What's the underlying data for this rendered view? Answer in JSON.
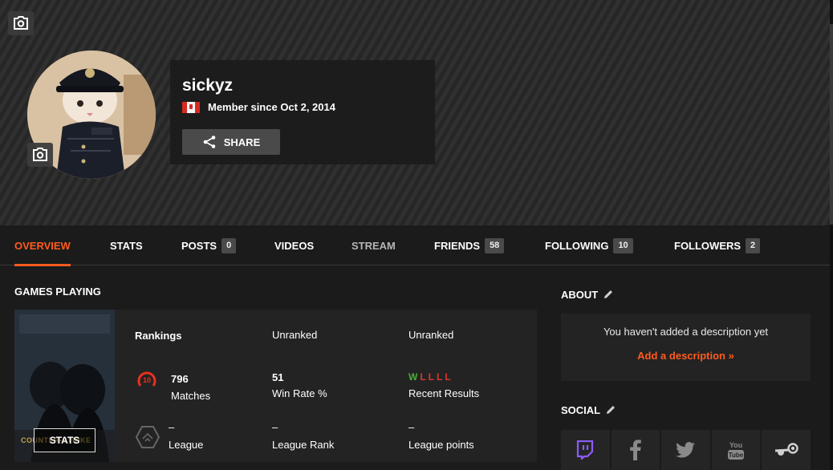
{
  "profile": {
    "username": "sickyz",
    "member_since": "Member since Oct 2, 2014",
    "share_label": "SHARE",
    "flag": "canada-flag-icon"
  },
  "tabs": [
    {
      "label": "OVERVIEW",
      "active": true
    },
    {
      "label": "STATS"
    },
    {
      "label": "POSTS",
      "count": "0"
    },
    {
      "label": "VIDEOS"
    },
    {
      "label": "STREAM",
      "muted": true
    },
    {
      "label": "FRIENDS",
      "count": "58"
    },
    {
      "label": "FOLLOWING",
      "count": "10"
    },
    {
      "label": "FOLLOWERS",
      "count": "2"
    }
  ],
  "games": {
    "title": "GAMES PLAYING",
    "cover_logo": "COUNTER-STRIKE",
    "stats_button": "STATS",
    "rankings_label": "Rankings",
    "ranking_1": "Unranked",
    "ranking_2": "Unranked",
    "skill_level": "10",
    "matches_value": "796",
    "matches_label": "Matches",
    "winrate_value": "51",
    "winrate_label": "Win Rate %",
    "recent_results": [
      "W",
      "L",
      "L",
      "L",
      "L"
    ],
    "recent_label": "Recent Results",
    "league_value": "–",
    "league_label": "League",
    "league_rank_value": "–",
    "league_rank_label": "League Rank",
    "league_points_value": "–",
    "league_points_label": "League points"
  },
  "about": {
    "title": "ABOUT",
    "empty_text": "You haven't added a description yet",
    "add_link": "Add a description »"
  },
  "social": {
    "title": "SOCIAL",
    "icons": [
      "twitch-icon",
      "facebook-icon",
      "twitter-icon",
      "youtube-icon",
      "steam-icon"
    ]
  },
  "colors": {
    "accent": "#ff5b1f",
    "win": "#4caf3a",
    "loss": "#d9362b",
    "twitch": "#6441a5"
  }
}
